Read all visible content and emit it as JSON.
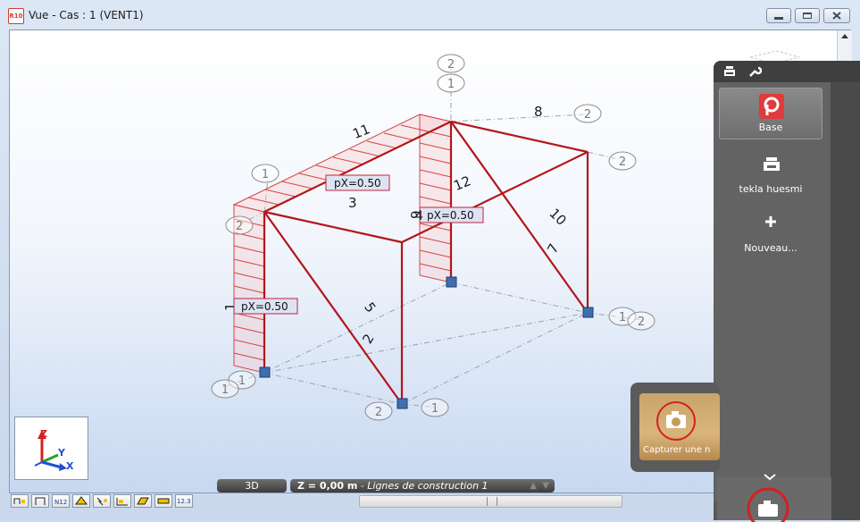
{
  "window": {
    "title": "Vue - Cas : 1 (VENT1)",
    "app_icon_text": "R10"
  },
  "loads": [
    "pX=0.50",
    "pX=0.50",
    "pX=0.50"
  ],
  "bar_numbers": [
    "11",
    "3",
    "12",
    "9",
    "8",
    "10",
    "7",
    "1",
    "5",
    "2",
    "4"
  ],
  "node_circles": [
    "2",
    "1",
    "2",
    "2",
    "1",
    "2",
    "1",
    "2",
    "1",
    "1",
    "2",
    "1"
  ],
  "axes": {
    "z": "Z",
    "y": "Y",
    "x": "X"
  },
  "status": {
    "mode": "3D",
    "z_value": "Z = 0,00 m",
    "construction_lines": "Lignes de construction 1"
  },
  "side_panel": {
    "items": [
      {
        "label": "Base",
        "icon": "base-logo-icon",
        "selected": true
      },
      {
        "label": "tekla huesmi",
        "icon": "printer-icon",
        "selected": false
      },
      {
        "label": "Nouveau...",
        "icon": "plus-icon",
        "selected": false
      }
    ],
    "capture_label": "Capturer une n"
  },
  "colors": {
    "structure": "#b3161a",
    "load_fill": "#e25050",
    "support": "#3d6fb0",
    "panel": "#5a5a5a"
  }
}
